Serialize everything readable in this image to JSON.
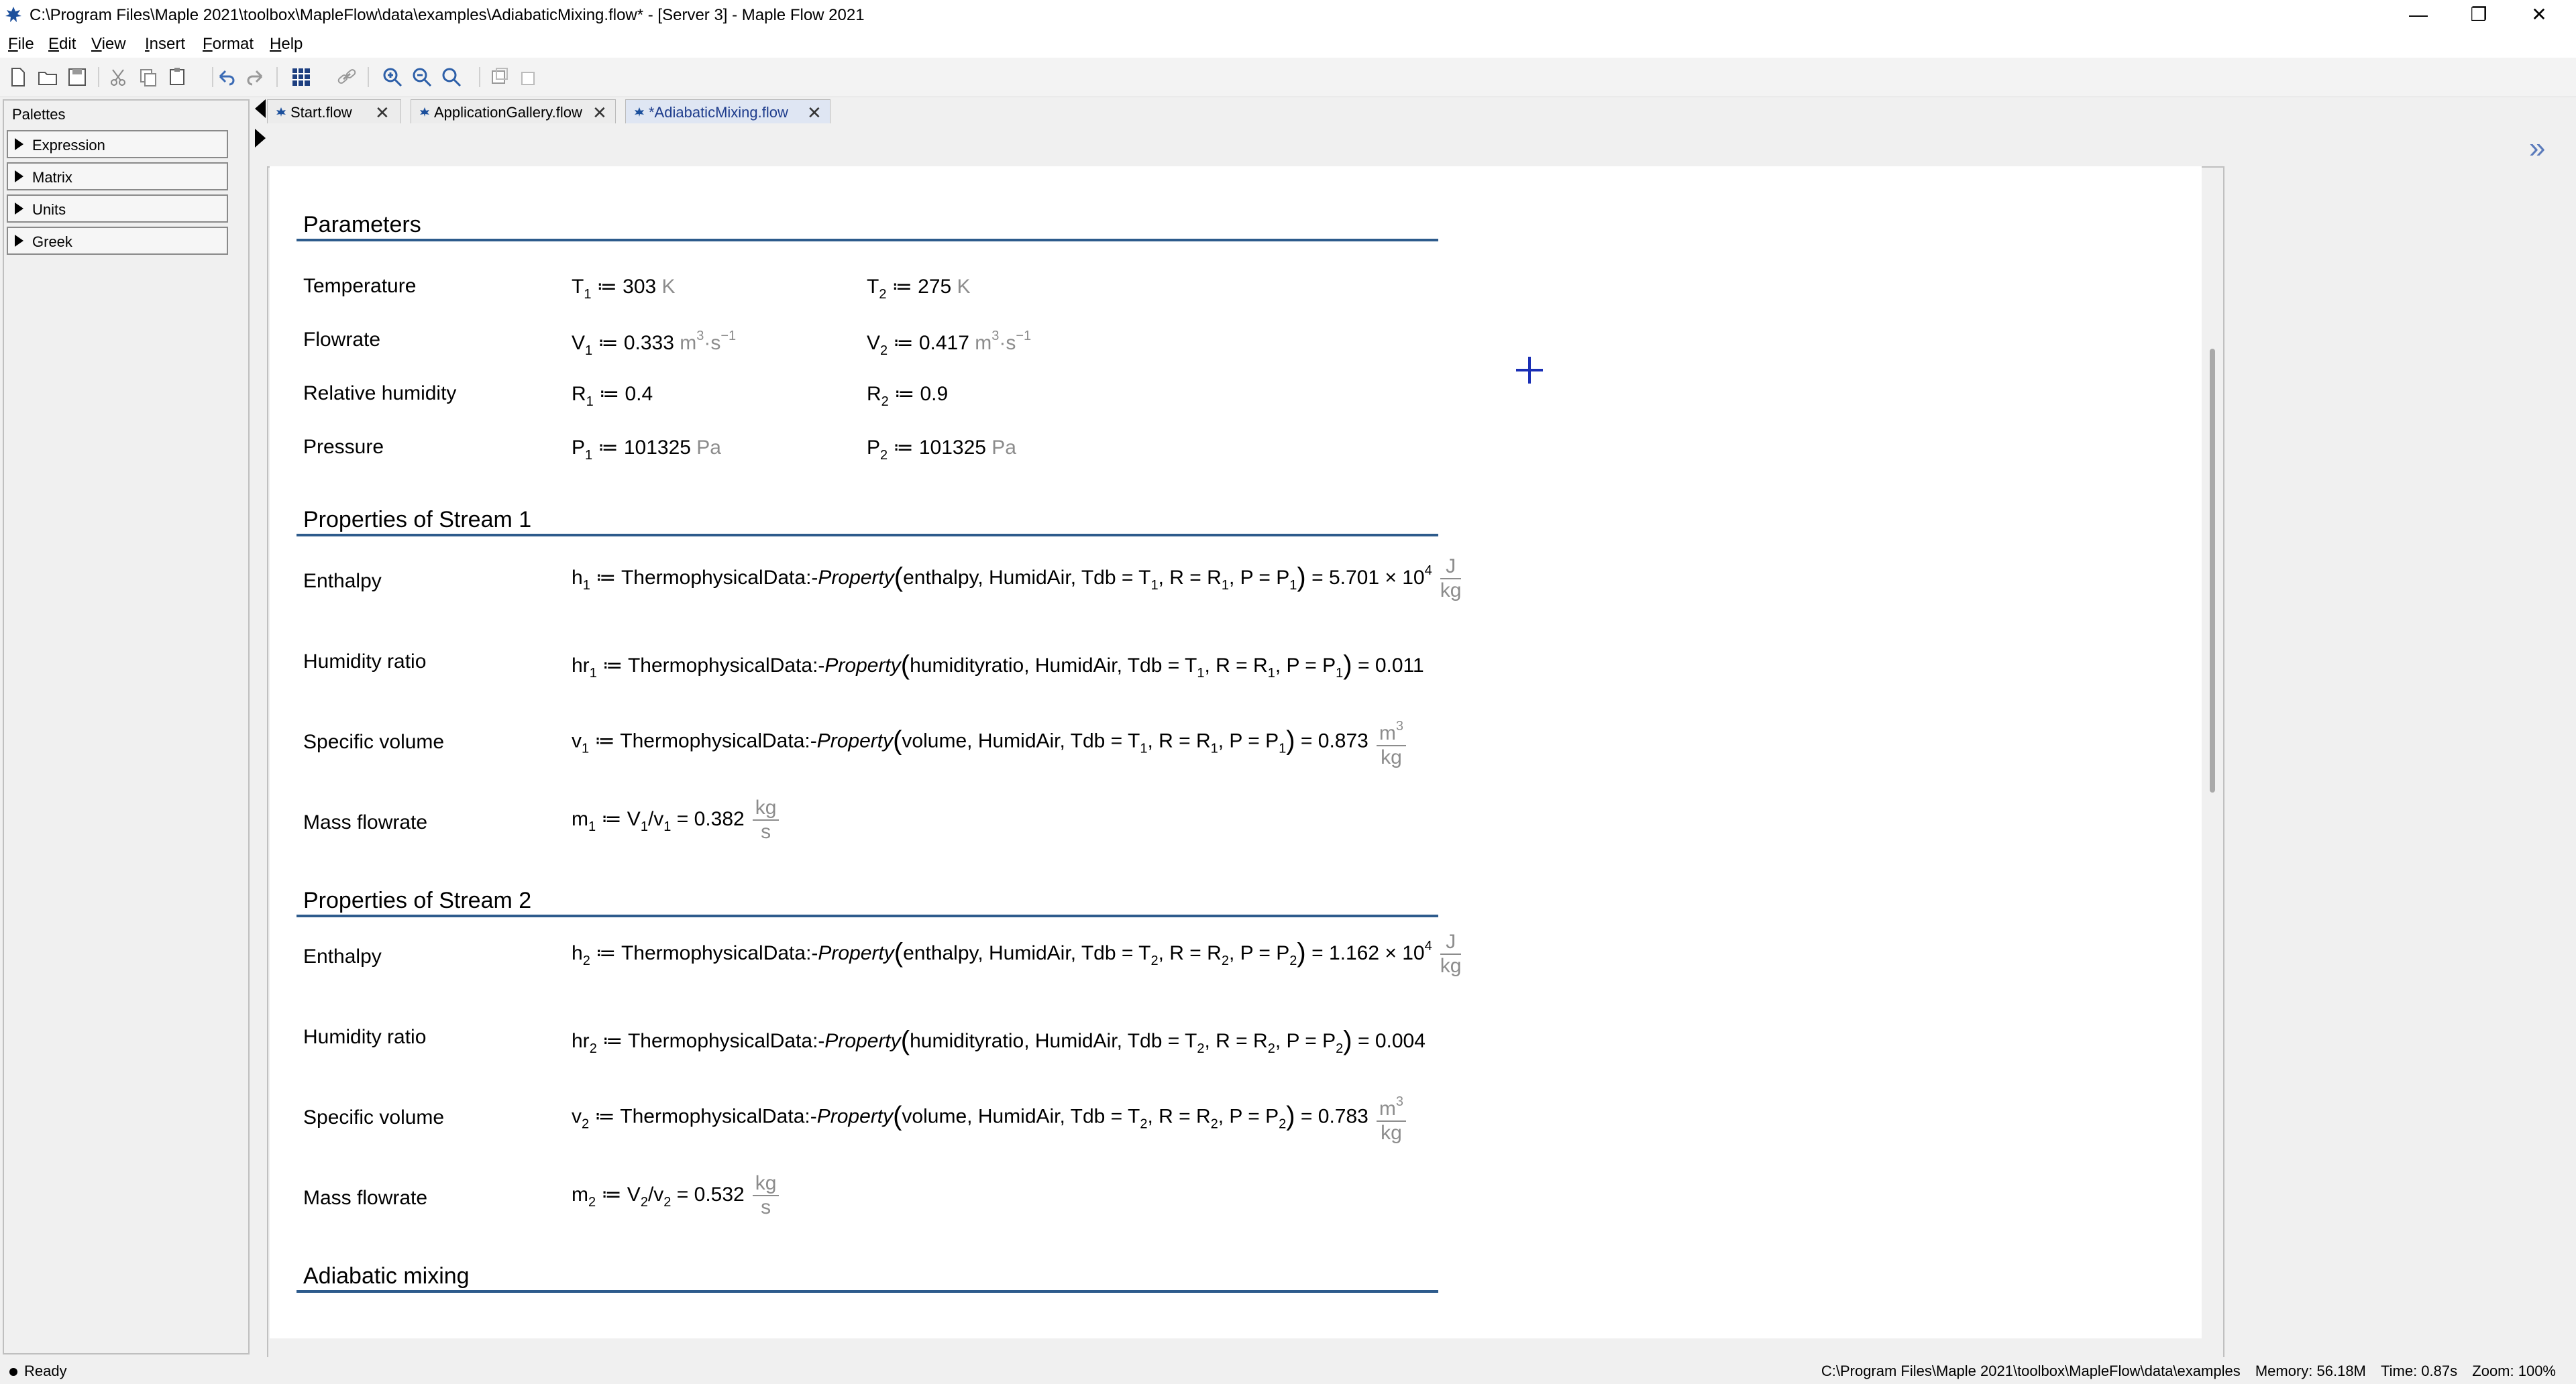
{
  "window": {
    "title": "C:\\Program Files\\Maple 2021\\toolbox\\MapleFlow\\data\\examples\\AdiabaticMixing.flow* - [Server 3] - Maple Flow 2021",
    "minimize": "—",
    "restore": "❐",
    "close": "✕"
  },
  "menu": [
    "File",
    "Edit",
    "View",
    "Insert",
    "Format",
    "Help"
  ],
  "palettes": {
    "title": "Palettes",
    "items": [
      "Expression",
      "Matrix",
      "Units",
      "Greek"
    ]
  },
  "tabs": [
    {
      "label": "Start.flow",
      "active": false
    },
    {
      "label": "ApplicationGallery.flow",
      "active": false
    },
    {
      "label": "*AdiabaticMixing.flow",
      "active": true
    }
  ],
  "doc": {
    "sections": {
      "parameters": "Parameters",
      "stream1": "Properties of Stream 1",
      "stream2": "Properties of Stream 2",
      "mixing": "Adiabatic mixing"
    },
    "labels": {
      "temperature": "Temperature",
      "flowrate": "Flowrate",
      "relative_humidity": "Relative humidity",
      "pressure": "Pressure",
      "enthalpy": "Enthalpy",
      "humidity_ratio": "Humidity ratio",
      "specific_volume": "Specific volume",
      "mass_flowrate": "Mass flowrate"
    },
    "values": {
      "T1": "303",
      "T2": "275",
      "V1": "0.333",
      "V2": "0.417",
      "R1": "0.4",
      "R2": "0.9",
      "P1": "101325",
      "P2": "101325",
      "h1": "5.701",
      "hr1": "0.011",
      "v1": "0.873",
      "m1": "0.382",
      "h2": "1.162",
      "hr2": "0.004",
      "v2": "0.783",
      "m2": "0.532",
      "exp4": "4"
    },
    "units": {
      "K": "K",
      "Pa": "Pa",
      "m": "m",
      "s": "s",
      "J": "J",
      "kg": "kg"
    },
    "tokens": {
      "assign": "≔",
      "eq": "=",
      "times10": "× 10",
      "thermo": "ThermophysicalData:-",
      "property": "Property",
      "enthalpy_arg": "enthalpy",
      "humidityratio_arg": "humidityratio",
      "volume_arg": "volume",
      "humidair": "HumidAir"
    }
  },
  "status": {
    "ready": "Ready",
    "path": "C:\\Program Files\\Maple 2021\\toolbox\\MapleFlow\\data\\examples",
    "memory": "Memory: 56.18M",
    "time": "Time: 0.87s",
    "zoom": "Zoom: 100%"
  }
}
